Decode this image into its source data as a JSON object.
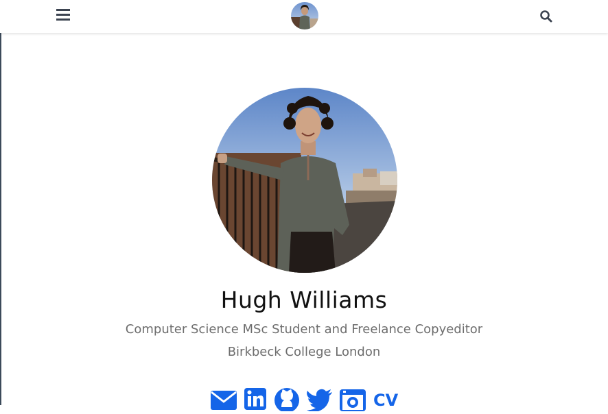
{
  "nav": {
    "menu_icon": "hamburger-menu-icon",
    "search_icon": "search-icon"
  },
  "profile": {
    "name": "Hugh Williams",
    "tagline": "Computer Science MSc Student and Freelance Copyeditor",
    "affiliation": "Birkbeck College London"
  },
  "social": {
    "icons": [
      "envelope-icon",
      "linkedin-icon",
      "github-icon",
      "twitter-icon",
      "scholar-icon"
    ],
    "cv_label": "CV"
  },
  "colors": {
    "accent": "#1565e8",
    "text": "#111111",
    "muted": "#6d6d6d"
  }
}
